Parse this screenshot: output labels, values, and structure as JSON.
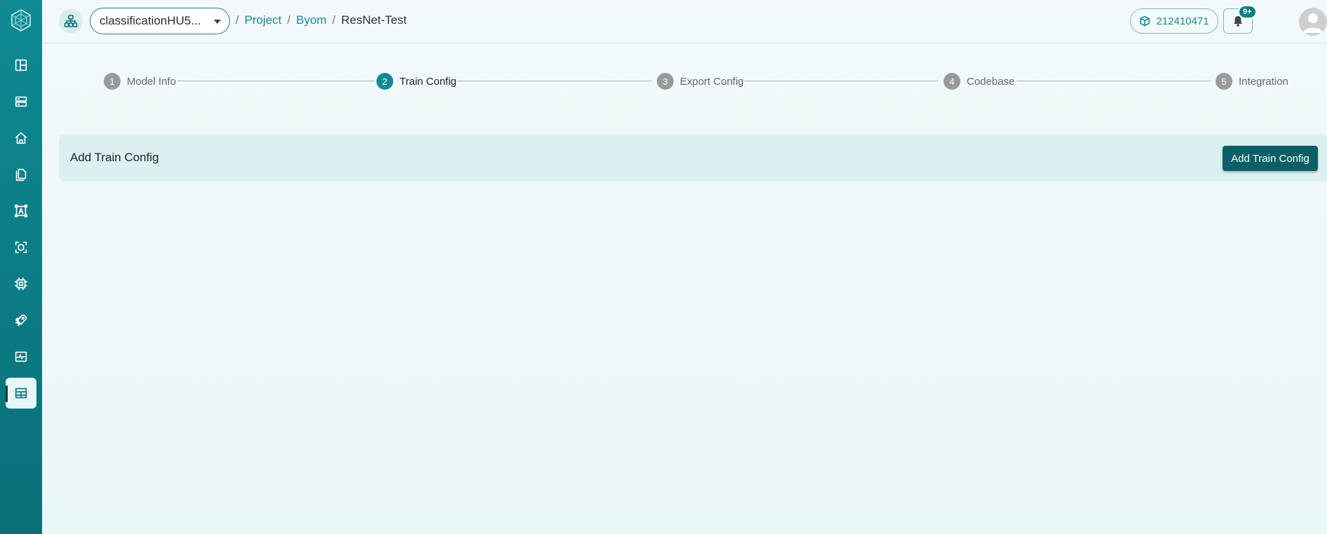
{
  "project": {
    "selected": "classificationHU5...",
    "icon": "project-hierarchy-icon"
  },
  "breadcrumb": {
    "items": [
      "Project",
      "Byom"
    ],
    "current": "ResNet-Test",
    "separator": "/"
  },
  "header": {
    "credits": "212410471",
    "notifications_badge": "9+"
  },
  "sidebar": {
    "items": [
      {
        "icon": "dashboard-icon"
      },
      {
        "icon": "storage-icon"
      },
      {
        "icon": "home-icon"
      },
      {
        "icon": "documents-icon"
      },
      {
        "icon": "annotation-icon"
      },
      {
        "icon": "model-cube-icon"
      },
      {
        "icon": "chip-icon"
      },
      {
        "icon": "rocket-icon"
      },
      {
        "icon": "monitoring-icon"
      },
      {
        "icon": "byom-icon",
        "active": true
      }
    ]
  },
  "stepper": {
    "steps": [
      {
        "num": "1",
        "label": "Model Info"
      },
      {
        "num": "2",
        "label": "Train Config",
        "active": true
      },
      {
        "num": "3",
        "label": "Export Config"
      },
      {
        "num": "4",
        "label": "Codebase"
      },
      {
        "num": "5",
        "label": "Integration"
      }
    ]
  },
  "config": {
    "title": "Add Train Config",
    "button_label": "Add Train Config"
  },
  "colors": {
    "primary": "#0e8a93",
    "button": "#0b5f67",
    "active_step": "#128a93",
    "inactive_step": "#9a9a9a"
  }
}
